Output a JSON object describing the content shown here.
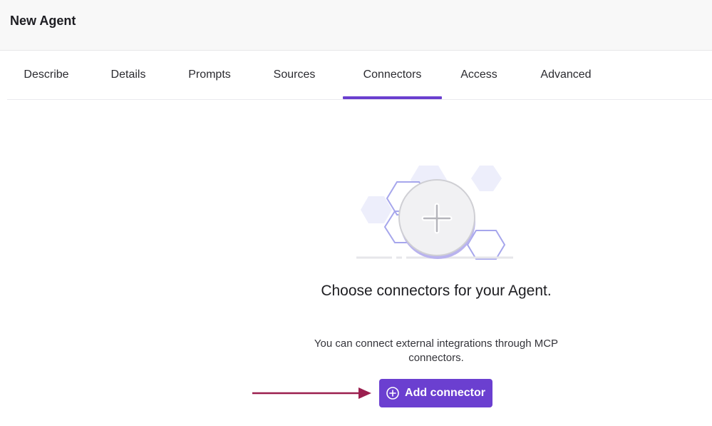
{
  "header": {
    "title": "New Agent"
  },
  "tabs": [
    {
      "label": "Describe"
    },
    {
      "label": "Details"
    },
    {
      "label": "Prompts"
    },
    {
      "label": "Sources"
    },
    {
      "label": "Connectors",
      "active": true
    },
    {
      "label": "Access"
    },
    {
      "label": "Advanced"
    }
  ],
  "empty_state": {
    "headline": "Choose connectors for your Agent.",
    "description": "You can connect external integrations through MCP connectors.",
    "button_label": "Add connector",
    "illustration_icon": "plus-icon"
  },
  "colors": {
    "accent": "#6b3fd0",
    "arrow": "#9b1f4f",
    "header_bg": "#f8f8f8"
  }
}
